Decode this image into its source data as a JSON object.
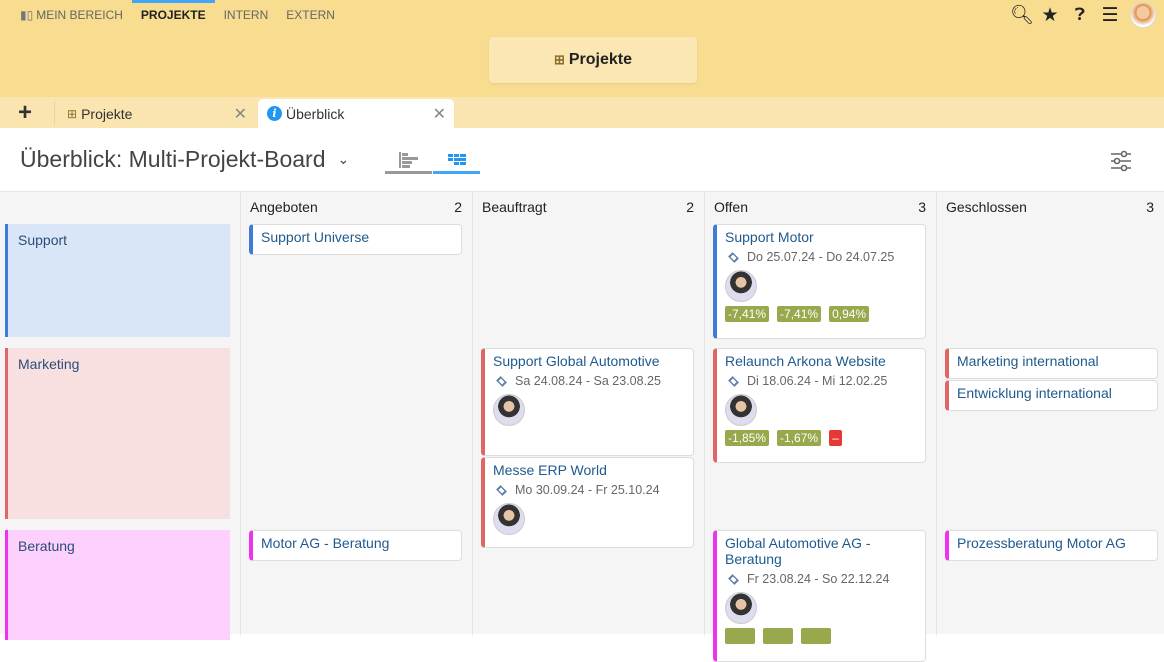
{
  "nav": {
    "items": [
      {
        "label": "MEIN BEREICH",
        "active": false
      },
      {
        "label": "PROJEKTE",
        "active": true
      },
      {
        "label": "INTERN",
        "active": false
      },
      {
        "label": "EXTERN",
        "active": false
      }
    ],
    "icons": [
      "search-icon",
      "star-icon",
      "help-icon",
      "menu-icon",
      "user-avatar"
    ]
  },
  "header": {
    "button": "Projekte"
  },
  "tabs": [
    {
      "label": "Projekte",
      "active": false
    },
    {
      "label": "Überblick",
      "active": true
    }
  ],
  "page": {
    "title": "Überblick: Multi-Projekt-Board"
  },
  "columns": [
    {
      "label": "Angeboten",
      "count": "2"
    },
    {
      "label": "Beauftragt",
      "count": "2"
    },
    {
      "label": "Offen",
      "count": "3"
    },
    {
      "label": "Geschlossen",
      "count": "3"
    }
  ],
  "lanes": [
    {
      "label": "Support",
      "color": "#3d7bd6",
      "bg": "#d8e6f8"
    },
    {
      "label": "Marketing",
      "color": "#e06666",
      "bg": "#f8e0e0"
    },
    {
      "label": "Beratung",
      "color": "#ee33ee",
      "bg": "#fdd0fd"
    }
  ],
  "cards": [
    {
      "lane": 0,
      "col": 0,
      "title": "Support Universe"
    },
    {
      "lane": 0,
      "col": 2,
      "title": "Support Motor",
      "date": "Do 25.07.24 - Do 24.07.25",
      "avatar": true,
      "pills": [
        "-7,41%",
        "-7,41%",
        "0,94%"
      ]
    },
    {
      "lane": 1,
      "col": 1,
      "title": "Support Global Automotive",
      "date": "Sa 24.08.24 - Sa 23.08.25",
      "avatar": true
    },
    {
      "lane": 1,
      "col": 1,
      "title": "Messe ERP World",
      "date": "Mo 30.09.24 - Fr 25.10.24",
      "avatar": true
    },
    {
      "lane": 1,
      "col": 2,
      "title": "Relaunch Arkona Website",
      "date": "Di 18.06.24 - Mi 12.02.25",
      "avatar": true,
      "pills": [
        "-1,85%",
        "-1,67%",
        "–"
      ]
    },
    {
      "lane": 1,
      "col": 3,
      "title": "Marketing international"
    },
    {
      "lane": 1,
      "col": 3,
      "title": "Entwicklung international"
    },
    {
      "lane": 2,
      "col": 0,
      "title": "Motor AG - Beratung"
    },
    {
      "lane": 2,
      "col": 2,
      "title": "Global Automotive AG - Beratung",
      "date": "Fr 23.08.24 - So 22.12.24",
      "avatar": true,
      "pills": [
        "",
        "",
        ""
      ]
    },
    {
      "lane": 2,
      "col": 3,
      "title": "Prozessberatung Motor AG"
    }
  ]
}
